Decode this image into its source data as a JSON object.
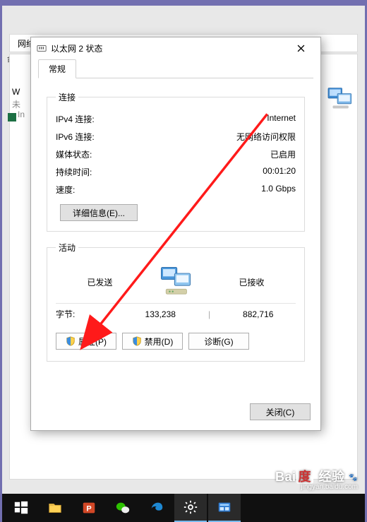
{
  "bg": {
    "toolbar_label": "网络",
    "rename_label": "命名此",
    "adapter_short": "W",
    "unidentified": "未",
    "vendor": "In"
  },
  "dialog": {
    "title": "以太网 2 状态",
    "tab_general": "常规",
    "connection": {
      "legend": "连接",
      "rows": {
        "ipv4_label": "IPv4 连接:",
        "ipv4_value": "Internet",
        "ipv6_label": "IPv6 连接:",
        "ipv6_value": "无网络访问权限",
        "media_label": "媒体状态:",
        "media_value": "已启用",
        "duration_label": "持续时间:",
        "duration_value": "00:01:20",
        "speed_label": "速度:",
        "speed_value": "1.0 Gbps"
      },
      "details_btn": "详细信息(E)..."
    },
    "activity": {
      "legend": "活动",
      "sent_label": "已发送",
      "recv_label": "已接收",
      "bytes_label": "字节:",
      "bytes_sent": "133,238",
      "bytes_recv": "882,716",
      "properties_btn": "属性(P)",
      "disable_btn": "禁用(D)",
      "diagnose_btn": "诊断(G)"
    },
    "close_btn": "关闭(C)"
  },
  "watermark": {
    "brand_du": "度",
    "brand_rest": "Bai",
    "brand_cn": "经验",
    "url": "jingyan.baidu.com"
  }
}
